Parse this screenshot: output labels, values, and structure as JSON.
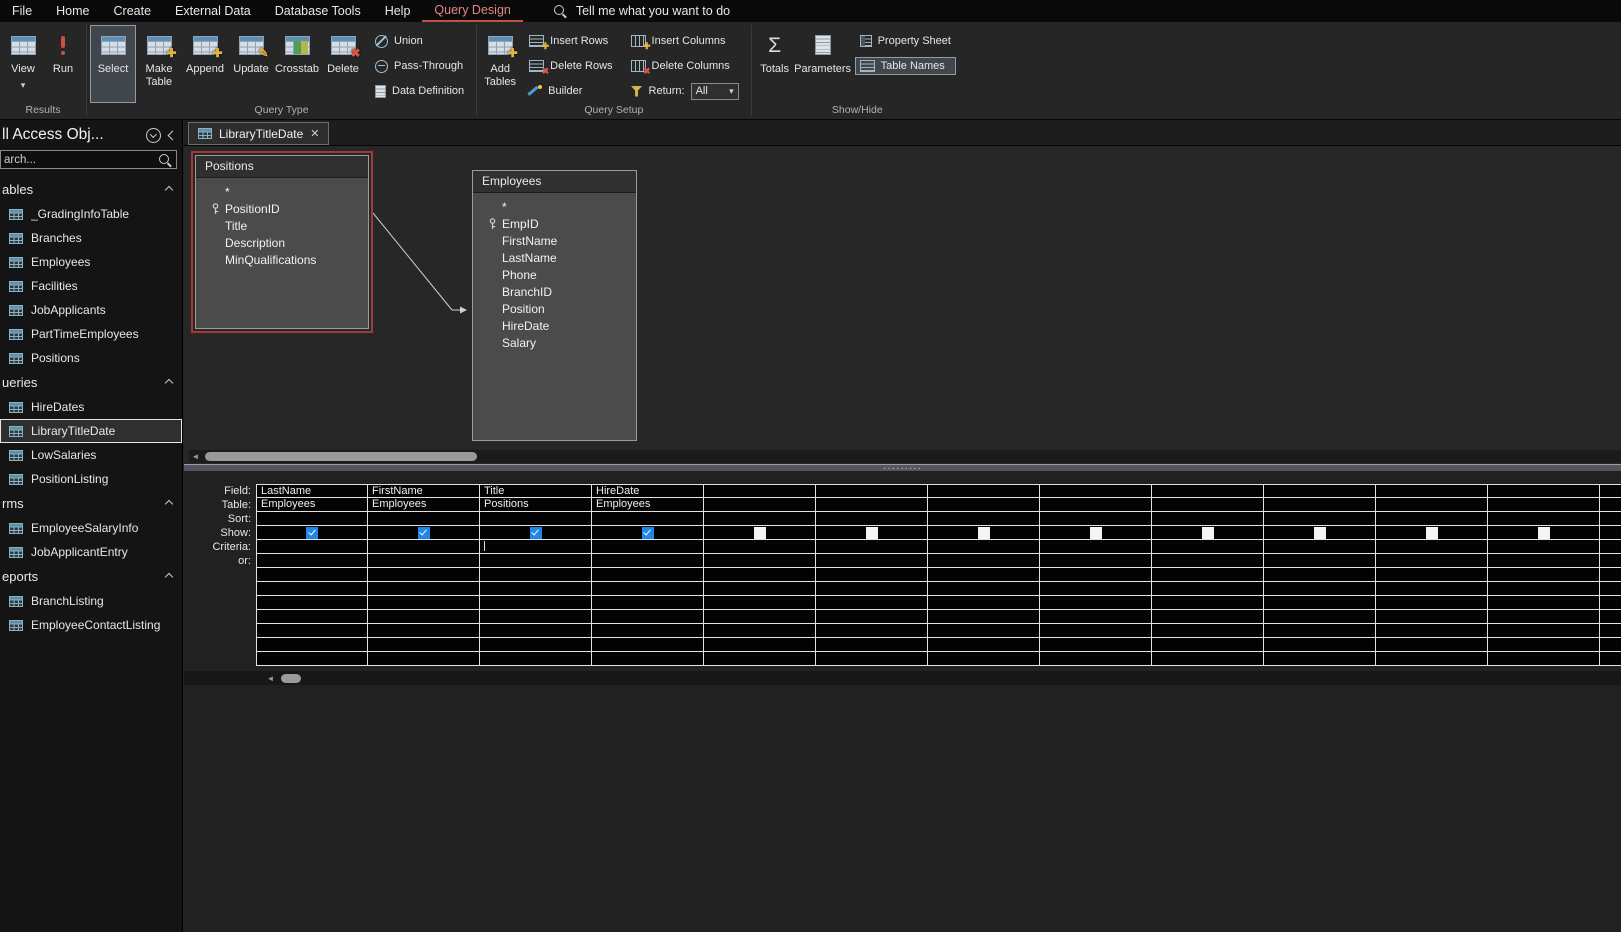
{
  "icons": {
    "close": "✕",
    "dropdown": "▾",
    "scroll_left": "◄",
    "sigma": "Σ",
    "overlay_plus": "✚",
    "overlay_cross": "✖",
    "overlay_pencil": "✎"
  },
  "colors": {
    "accent_red": "#c24f4a",
    "checkbox_blue": "#2186e8",
    "selection_red_border": "#a03c38"
  },
  "menubar": {
    "items": [
      {
        "label": "File"
      },
      {
        "label": "Home"
      },
      {
        "label": "Create"
      },
      {
        "label": "External Data"
      },
      {
        "label": "Database Tools"
      },
      {
        "label": "Help"
      },
      {
        "label": "Query Design",
        "active": true
      }
    ],
    "tell_me": "Tell me what you want to do"
  },
  "ribbon": {
    "results": {
      "label": "Results",
      "view": "View",
      "run": "Run"
    },
    "query_type": {
      "label": "Query Type",
      "select": "Select",
      "make_table": "Make Table",
      "append": "Append",
      "update": "Update",
      "crosstab": "Crosstab",
      "delete": "Delete",
      "union": "Union",
      "pass_through": "Pass-Through",
      "data_definition": "Data Definition"
    },
    "query_setup": {
      "label": "Query Setup",
      "add_tables": "Add Tables",
      "insert_rows": "Insert Rows",
      "delete_rows": "Delete Rows",
      "builder": "Builder",
      "insert_columns": "Insert Columns",
      "delete_columns": "Delete Columns",
      "return_label": "Return:",
      "return_value": "All"
    },
    "show_hide": {
      "label": "Show/Hide",
      "totals": "Totals",
      "parameters": "Parameters",
      "property_sheet": "Property Sheet",
      "table_names": "Table Names"
    }
  },
  "sidebar": {
    "title": "ll Access Obj...",
    "search_placeholder": "arch...",
    "groups": [
      {
        "label": "ables",
        "type": "table",
        "items": [
          "_GradingInfoTable",
          "Branches",
          "Employees",
          "Facilities",
          "JobApplicants",
          "PartTimeEmployees",
          "Positions"
        ]
      },
      {
        "label": "ueries",
        "type": "query",
        "selected": "LibraryTitleDate",
        "items": [
          "HireDates",
          "LibraryTitleDate",
          "LowSalaries",
          "PositionListing"
        ]
      },
      {
        "label": "rms",
        "type": "form",
        "items": [
          "EmployeeSalaryInfo",
          "JobApplicantEntry"
        ]
      },
      {
        "label": "eports",
        "type": "report",
        "items": [
          "BranchListing",
          "EmployeeContactListing"
        ]
      }
    ]
  },
  "tab": {
    "title": "LibraryTitleDate"
  },
  "design": {
    "tables": [
      {
        "name": "Positions",
        "selected": true,
        "key_field": "PositionID",
        "fields": [
          "*",
          "PositionID",
          "Title",
          "Description",
          "MinQualifications"
        ]
      },
      {
        "name": "Employees",
        "selected": false,
        "key_field": "EmpID",
        "fields": [
          "*",
          "EmpID",
          "FirstName",
          "LastName",
          "Phone",
          "BranchID",
          "Position",
          "HireDate",
          "Salary"
        ]
      }
    ],
    "join": {
      "from": "Positions",
      "to": "Employees"
    }
  },
  "grid": {
    "row_labels": [
      "Field:",
      "Table:",
      "Sort:",
      "Show:",
      "Criteria:",
      "or:"
    ],
    "extra_rows": 7,
    "columns": [
      {
        "field": "LastName",
        "table": "Employees",
        "show": true
      },
      {
        "field": "FirstName",
        "table": "Employees",
        "show": true
      },
      {
        "field": "Title",
        "table": "Positions",
        "show": true,
        "criteria_caret": true
      },
      {
        "field": "HireDate",
        "table": "Employees",
        "show": true
      },
      {
        "field": "",
        "table": "",
        "show": false
      },
      {
        "field": "",
        "table": "",
        "show": false
      },
      {
        "field": "",
        "table": "",
        "show": false
      },
      {
        "field": "",
        "table": "",
        "show": false
      },
      {
        "field": "",
        "table": "",
        "show": false
      },
      {
        "field": "",
        "table": "",
        "show": false
      },
      {
        "field": "",
        "table": "",
        "show": false
      },
      {
        "field": "",
        "table": "",
        "show": false
      },
      {
        "field": "",
        "table": "",
        "show": false
      }
    ]
  }
}
